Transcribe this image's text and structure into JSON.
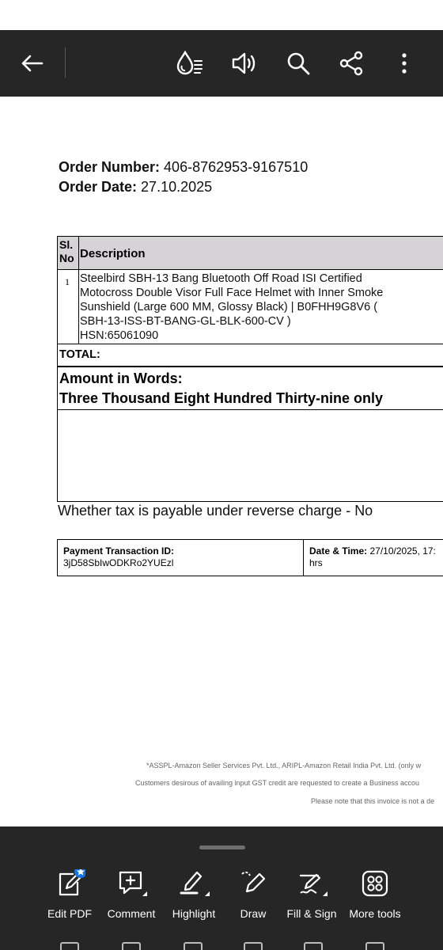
{
  "toolbar": {
    "icons": [
      "back-arrow-icon",
      "liquid-mode-icon",
      "read-aloud-icon",
      "search-icon",
      "share-icon",
      "more-vertical-icon"
    ]
  },
  "document": {
    "order_number_label": "Order Number:",
    "order_number_value": "406-8762953-9167510",
    "order_date_label": "Order Date:",
    "order_date_value": "27.10.2025",
    "table_headers": [
      "Sl.\nNo",
      "Description"
    ],
    "items": [
      {
        "sl_no": "1",
        "description_lines": [
          "Steelbird SBH-13 Bang Bluetooth Off Road ISI Certified",
          "Motocross Double Visor Full Face Helmet with Inner Smoke",
          "Sunshield (Large 600 MM, Glossy Black) | B0FHH9G8V6 (",
          "SBH-13-ISS-BT-BANG-GL-BLK-600-CV )",
          "HSN:65061090"
        ]
      }
    ],
    "total_label": "TOTAL:",
    "amount_in_words_label": "Amount in Words:",
    "amount_in_words_value": "Three Thousand Eight Hundred Thirty-nine only",
    "reverse_charge_text": "Whether tax is payable under reverse charge - No",
    "payment": {
      "transaction_id_label": "Payment Transaction ID:",
      "transaction_id_value": "3jD58SbIwODKRo2YUEzl",
      "datetime_label": "Date & Time:",
      "datetime_value": "27/10/2025, 17:",
      "datetime_suffix": "hrs"
    },
    "footnotes": [
      "*ASSPL-Amazon Seller Services Pvt. Ltd., ARIPL-Amazon Retail India Pvt. Ltd. (only w",
      "Customers desirous of availing input GST credit are requested to create a Business accou",
      "Please note that this invoice is not a de"
    ]
  },
  "bottom_tools": [
    {
      "label": "Edit PDF",
      "icon": "edit-pdf-icon",
      "badge": "star-badge-icon"
    },
    {
      "label": "Comment",
      "icon": "comment-icon"
    },
    {
      "label": "Highlight",
      "icon": "highlight-icon"
    },
    {
      "label": "Draw",
      "icon": "draw-icon"
    },
    {
      "label": "Fill & Sign",
      "icon": "fill-sign-icon"
    },
    {
      "label": "More tools",
      "icon": "more-tools-icon"
    }
  ],
  "colors": {
    "toolbar_bg": "#262626",
    "table_header_bg": "#d6d3d6",
    "badge_blue": "#1473e6",
    "icon_white": "#ffffff"
  }
}
